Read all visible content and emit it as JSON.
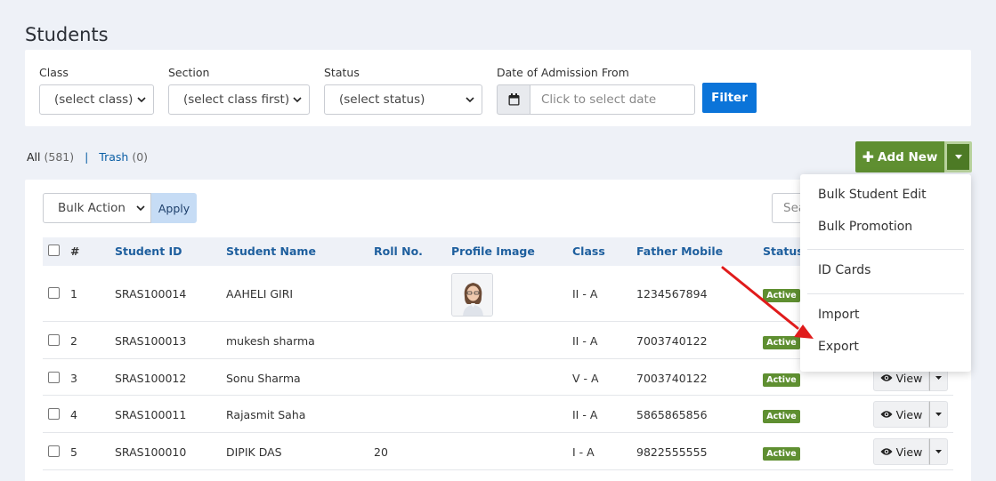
{
  "page": {
    "title": "Students"
  },
  "filters": {
    "class": {
      "label": "Class",
      "value": "(select class)"
    },
    "section": {
      "label": "Section",
      "value": "(select class first)"
    },
    "status": {
      "label": "Status",
      "value": "(select status)"
    },
    "date": {
      "label": "Date of Admission From",
      "placeholder": "Click to select date"
    },
    "filter_label": "Filter"
  },
  "tabs": {
    "all_label": "All",
    "all_count": "(581)",
    "separator": "|",
    "trash_label": "Trash",
    "trash_count": "(0)"
  },
  "actions": {
    "add_new_label": "Add New"
  },
  "toolbar": {
    "bulk_action": "Bulk Action",
    "apply_label": "Apply",
    "search_placeholder": "Search"
  },
  "table": {
    "headers": {
      "num": "#",
      "student_id": "Student ID",
      "student_name": "Student Name",
      "roll_no": "Roll No.",
      "profile_image": "Profile Image",
      "class": "Class",
      "father_mobile": "Father Mobile",
      "status": "Status"
    },
    "rows": [
      {
        "num": "1",
        "student_id": "SRAS100014",
        "name": "AAHELI GIRI",
        "roll": "",
        "class": "II - A",
        "mobile": "1234567894",
        "status": "Active"
      },
      {
        "num": "2",
        "student_id": "SRAS100013",
        "name": "mukesh sharma",
        "roll": "",
        "class": "II - A",
        "mobile": "7003740122",
        "status": "Active"
      },
      {
        "num": "3",
        "student_id": "SRAS100012",
        "name": "Sonu Sharma",
        "roll": "",
        "class": "V - A",
        "mobile": "7003740122",
        "status": "Active",
        "view": "View"
      },
      {
        "num": "4",
        "student_id": "SRAS100011",
        "name": "Rajasmit Saha",
        "roll": "",
        "class": "II - A",
        "mobile": "5865865856",
        "status": "Active",
        "view": "View"
      },
      {
        "num": "5",
        "student_id": "SRAS100010",
        "name": "DIPIK DAS",
        "roll": "20",
        "class": "I - A",
        "mobile": "9822555555",
        "status": "Active",
        "view": "View"
      }
    ]
  },
  "dropdown": {
    "items": [
      "Bulk Student Edit",
      "Bulk Promotion",
      "ID Cards",
      "Import",
      "Export"
    ]
  },
  "colors": {
    "primary": "#0b74d9",
    "success": "#5f8f31",
    "link": "#1e5f9e",
    "annotation_arrow": "#e01b1b"
  },
  "icons": {
    "calendar": "calendar-icon",
    "plus": "plus-icon",
    "caret": "caret-down-icon",
    "eye": "eye-icon",
    "chevron": "chevron-down-icon"
  }
}
